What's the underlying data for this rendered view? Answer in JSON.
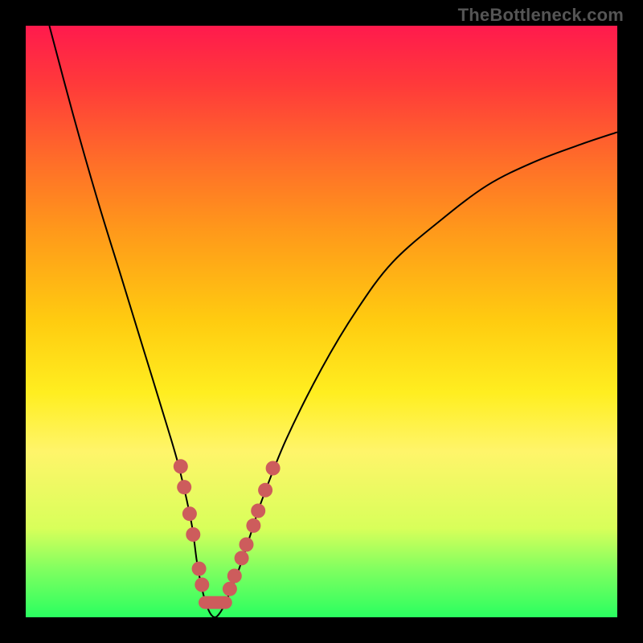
{
  "watermark": "TheBottleneck.com",
  "colors": {
    "frame": "#000000",
    "curve": "#000000",
    "marker": "#cd5c5c",
    "gradient_stops": [
      "#ff1a4d",
      "#ff3a3a",
      "#ff6a2a",
      "#ff9a1a",
      "#ffcc10",
      "#ffee20",
      "#fff56a",
      "#d8ff5a",
      "#7fff60",
      "#2aff60"
    ]
  },
  "chart_data": {
    "type": "line",
    "title": "",
    "xlabel": "",
    "ylabel": "",
    "xlim": [
      0,
      100
    ],
    "ylim": [
      0,
      100
    ],
    "legend": false,
    "grid": false,
    "annotations": [],
    "series": [
      {
        "name": "bottleneck-curve",
        "x": [
          4,
          8,
          12,
          16,
          20,
          24,
          26,
          28,
          29,
          30,
          31,
          32,
          33,
          34,
          36,
          38,
          40,
          44,
          50,
          56,
          62,
          70,
          78,
          86,
          94,
          100
        ],
        "y": [
          100,
          85,
          71,
          58,
          45,
          32,
          25,
          16,
          9,
          4,
          1,
          0,
          1,
          3,
          8,
          14,
          20,
          30,
          42,
          52,
          60,
          67,
          73,
          77,
          80,
          82
        ]
      }
    ],
    "minimum": {
      "x": 32,
      "y": 0
    },
    "marker_points_left": [
      {
        "x": 26.2,
        "y": 25.5
      },
      {
        "x": 26.8,
        "y": 22.0
      },
      {
        "x": 27.7,
        "y": 17.5
      },
      {
        "x": 28.3,
        "y": 14.0
      },
      {
        "x": 29.3,
        "y": 8.2
      },
      {
        "x": 29.8,
        "y": 5.5
      }
    ],
    "marker_points_right": [
      {
        "x": 34.5,
        "y": 4.8
      },
      {
        "x": 35.3,
        "y": 7.0
      },
      {
        "x": 36.5,
        "y": 10.0
      },
      {
        "x": 37.3,
        "y": 12.3
      },
      {
        "x": 38.5,
        "y": 15.5
      },
      {
        "x": 39.3,
        "y": 18.0
      },
      {
        "x": 40.5,
        "y": 21.5
      },
      {
        "x": 41.8,
        "y": 25.2
      }
    ],
    "marker_bottom": {
      "x_start": 30.3,
      "y_start": 2.5,
      "x_end": 33.8,
      "y_end": 2.5
    }
  }
}
